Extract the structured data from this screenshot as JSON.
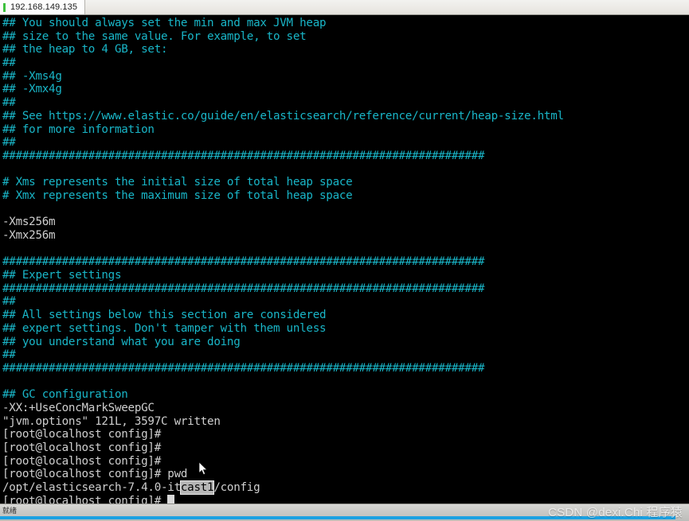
{
  "window": {
    "tab_label": "192.168.149.135",
    "tab_indicator_color": "#3ec13e"
  },
  "colors": {
    "terminal_background": "#000000",
    "comment_cyan": "#19b6c8",
    "text_white": "#cfcfcf",
    "selection_background": "#b6b6b6",
    "progress_blue": "#1ba1e2"
  },
  "terminal": {
    "lines": [
      {
        "text": "## You should always set the min and max JVM heap",
        "color": "cyan"
      },
      {
        "text": "## size to the same value. For example, to set",
        "color": "cyan"
      },
      {
        "text": "## the heap to 4 GB, set:",
        "color": "cyan"
      },
      {
        "text": "##",
        "color": "cyan"
      },
      {
        "text": "## -Xms4g",
        "color": "cyan"
      },
      {
        "text": "## -Xmx4g",
        "color": "cyan"
      },
      {
        "text": "##",
        "color": "cyan"
      },
      {
        "text": "## See https://www.elastic.co/guide/en/elasticsearch/reference/current/heap-size.html",
        "color": "cyan"
      },
      {
        "text": "## for more information",
        "color": "cyan"
      },
      {
        "text": "##",
        "color": "cyan"
      },
      {
        "text": "#########################################################################",
        "color": "cyan"
      },
      {
        "text": "",
        "color": "cyan"
      },
      {
        "text": "# Xms represents the initial size of total heap space",
        "color": "cyan"
      },
      {
        "text": "# Xmx represents the maximum size of total heap space",
        "color": "cyan"
      },
      {
        "text": "",
        "color": "cyan"
      },
      {
        "text": "-Xms256m",
        "color": "white"
      },
      {
        "text": "-Xmx256m",
        "color": "white"
      },
      {
        "text": "",
        "color": "cyan"
      },
      {
        "text": "#########################################################################",
        "color": "cyan"
      },
      {
        "text": "## Expert settings",
        "color": "cyan"
      },
      {
        "text": "#########################################################################",
        "color": "cyan"
      },
      {
        "text": "##",
        "color": "cyan"
      },
      {
        "text": "## All settings below this section are considered",
        "color": "cyan"
      },
      {
        "text": "## expert settings. Don't tamper with them unless",
        "color": "cyan"
      },
      {
        "text": "## you understand what you are doing",
        "color": "cyan"
      },
      {
        "text": "##",
        "color": "cyan"
      },
      {
        "text": "#########################################################################",
        "color": "cyan"
      },
      {
        "text": "",
        "color": "cyan"
      },
      {
        "text": "## GC configuration",
        "color": "cyan"
      },
      {
        "text": "-XX:+UseConcMarkSweepGC",
        "color": "white"
      },
      {
        "text": "\"jvm.options\" 121L, 3597C written",
        "color": "white"
      },
      {
        "text": "[root@localhost config]#",
        "color": "white"
      },
      {
        "text": "[root@localhost config]#",
        "color": "white"
      },
      {
        "text": "[root@localhost config]#",
        "color": "white"
      },
      {
        "text": "[root@localhost config]# pwd",
        "color": "white"
      }
    ],
    "path_line": {
      "prefix": "/opt/elasticsearch-7.4.0-it",
      "selected": "cast1",
      "suffix": "/config"
    },
    "prompt_line": {
      "prompt": "[root@localhost config]# ",
      "cursor": " "
    }
  },
  "statusbar": {
    "status_text": "就绪",
    "progress_percent": 98,
    "watermark": "CSDN @dexi.Chi 程序猿"
  }
}
